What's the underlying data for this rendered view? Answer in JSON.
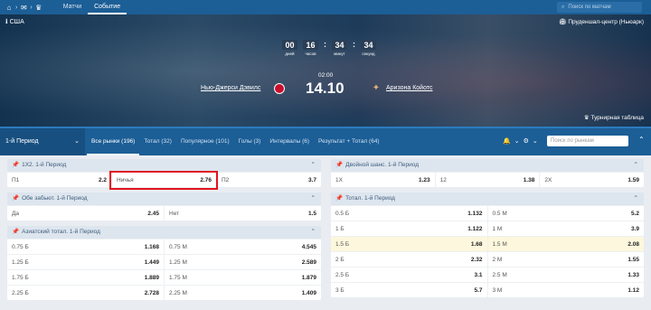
{
  "topnav": {
    "icons": [
      "home-icon",
      "mail-icon",
      "trophy-icon"
    ],
    "tabs": [
      "Матчи",
      "Событие"
    ],
    "active_tab": 1,
    "search_placeholder": "Поиск по матчам"
  },
  "hero": {
    "country": "США",
    "promo": "Пруденшал-центр (Ньюарк)",
    "timer": {
      "days": "00",
      "hours": "16",
      "minutes": "34",
      "seconds": "34",
      "labels": [
        "дней",
        "часов",
        "минут",
        "секунд"
      ]
    },
    "time": "02:00",
    "score": "14.10",
    "team_home": "Нью-Джерси Дэвилс",
    "team_away": "Аризона Койотс",
    "standings": "Турнирная таблица"
  },
  "marketbar": {
    "period": "1-й Период",
    "tabs": [
      "Все рынки (196)",
      "Тотал (32)",
      "Популярное (101)",
      "Голы (3)",
      "Интервалы (6)",
      "Результат + Тотал (64)"
    ],
    "active_tab": 0,
    "search_placeholder": "Поиск по рынкам"
  },
  "left": [
    {
      "title": "1X2. 1-й Период",
      "rows": [
        [
          [
            "П1",
            "2.2"
          ],
          [
            "Ничья",
            "2.76"
          ],
          [
            "П2",
            "3.7"
          ]
        ]
      ]
    },
    {
      "title": "Обе забьют. 1-й Период",
      "rows": [
        [
          [
            "Да",
            "2.45"
          ],
          [
            "Нет",
            "1.5"
          ]
        ]
      ]
    },
    {
      "title": "Азиатский тотал. 1-й Период",
      "rows": [
        [
          [
            "0.75 Б",
            "1.168"
          ],
          [
            "0.75 М",
            "4.545"
          ]
        ],
        [
          [
            "1.25 Б",
            "1.449"
          ],
          [
            "1.25 М",
            "2.589"
          ]
        ],
        [
          [
            "1.75 Б",
            "1.889"
          ],
          [
            "1.75 М",
            "1.879"
          ]
        ],
        [
          [
            "2.25 Б",
            "2.728"
          ],
          [
            "2.25 М",
            "1.409"
          ]
        ]
      ]
    }
  ],
  "right": [
    {
      "title": "Двойной шанс. 1-й Период",
      "rows": [
        [
          [
            "1X",
            "1.23"
          ],
          [
            "12",
            "1.38"
          ],
          [
            "2X",
            "1.59"
          ]
        ]
      ]
    },
    {
      "title": "Тотал. 1-й Период",
      "rows": [
        [
          [
            "0.5 Б",
            "1.132"
          ],
          [
            "0.5 М",
            "5.2"
          ]
        ],
        [
          [
            "1 Б",
            "1.122"
          ],
          [
            "1 М",
            "3.9"
          ]
        ],
        [
          [
            "1.5 Б",
            "1.68"
          ],
          [
            "1.5 М",
            "2.08"
          ]
        ],
        [
          [
            "2 Б",
            "2.32"
          ],
          [
            "2 М",
            "1.55"
          ]
        ],
        [
          [
            "2.5 Б",
            "3.1"
          ],
          [
            "2.5 М",
            "1.33"
          ]
        ],
        [
          [
            "3 Б",
            "5.7"
          ],
          [
            "3 М",
            "1.12"
          ]
        ]
      ],
      "highlight_row": 2
    }
  ]
}
